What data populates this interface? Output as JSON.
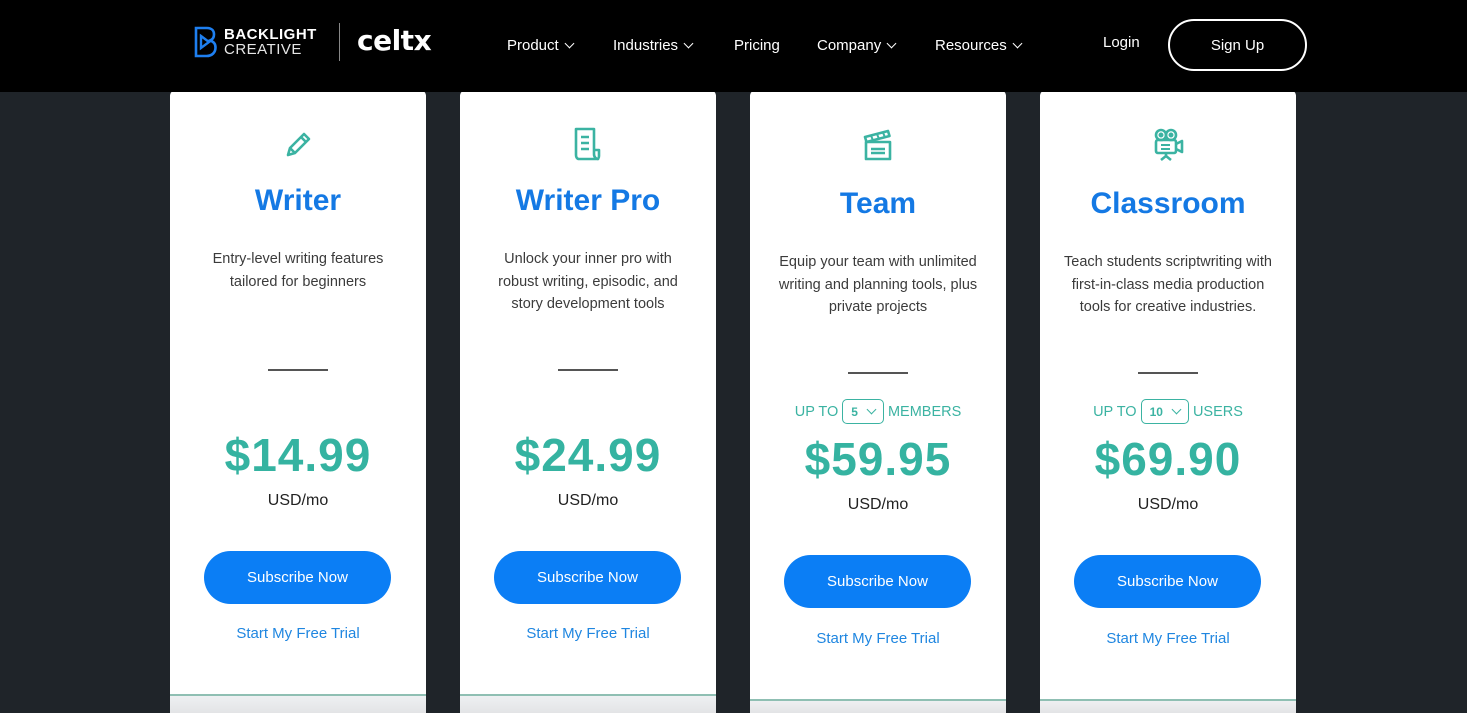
{
  "header": {
    "logo": {
      "line1": "BACKLIGHT",
      "line2": "CREATIVE",
      "product": "celtx"
    },
    "nav": [
      {
        "label": "Product",
        "has_dropdown": true
      },
      {
        "label": "Industries",
        "has_dropdown": true
      },
      {
        "label": "Pricing",
        "has_dropdown": false
      },
      {
        "label": "Company",
        "has_dropdown": true
      },
      {
        "label": "Resources",
        "has_dropdown": true
      }
    ],
    "login_label": "Login",
    "signup_label": "Sign Up"
  },
  "colors": {
    "brand_blue": "#1479e4",
    "button_blue": "#0b7ef5",
    "accent_teal": "#35b3a1",
    "page_bg": "#1f2429",
    "header_bg": "#000000"
  },
  "plans": [
    {
      "icon": "pencil-icon",
      "title": "Writer",
      "description": "Entry-level writing features tailored for beginners",
      "price": "$14.99",
      "period": "USD/mo",
      "subscribe_label": "Subscribe Now",
      "trial_label": "Start My Free Trial"
    },
    {
      "icon": "script-document-icon",
      "title": "Writer Pro",
      "description": "Unlock your inner pro with robust writing, episodic, and story development tools",
      "price": "$24.99",
      "period": "USD/mo",
      "subscribe_label": "Subscribe Now",
      "trial_label": "Start My Free Trial"
    },
    {
      "icon": "clapperboard-icon",
      "title": "Team",
      "description": "Equip your team with unlimited writing and planning tools, plus private projects",
      "qty_prefix": "UP TO",
      "qty_value": "5",
      "qty_suffix": "MEMBERS",
      "price": "$59.95",
      "period": "USD/mo",
      "subscribe_label": "Subscribe Now",
      "trial_label": "Start My Free Trial"
    },
    {
      "icon": "film-camera-icon",
      "title": "Classroom",
      "description": "Teach students scriptwriting with first-in-class media production tools for creative industries.",
      "qty_prefix": "UP TO",
      "qty_value": "10",
      "qty_suffix": "USERS",
      "price": "$69.90",
      "period": "USD/mo",
      "subscribe_label": "Subscribe Now",
      "trial_label": "Start My Free Trial"
    }
  ]
}
